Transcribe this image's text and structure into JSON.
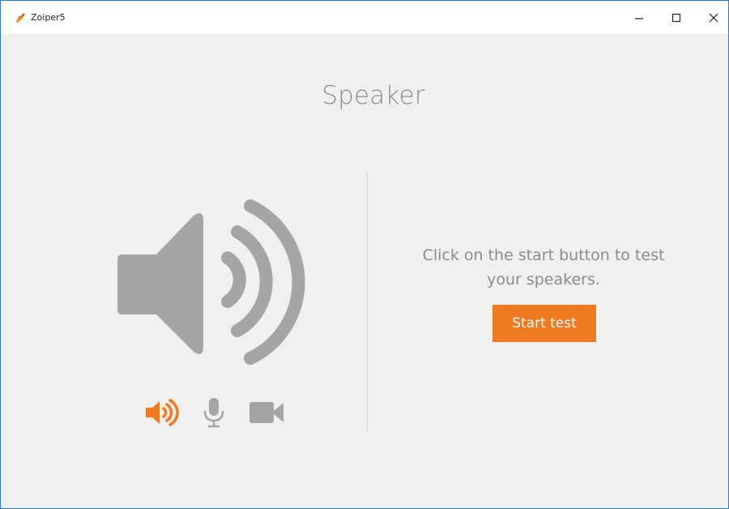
{
  "window": {
    "title": "Zoiper5"
  },
  "main": {
    "title": "Speaker",
    "instruction_line1": "Click on the start button to test",
    "instruction_line2": "your speakers.",
    "start_button_label": "Start test"
  },
  "tabs": [
    {
      "name": "speaker",
      "icon": "speaker-icon",
      "active": true
    },
    {
      "name": "microphone",
      "icon": "microphone-icon",
      "active": false
    },
    {
      "name": "video",
      "icon": "video-camera-icon",
      "active": false
    }
  ],
  "colors": {
    "accent": "#f07a22",
    "icon_gray": "#a5a5a7",
    "text_gray": "#8c8c8c",
    "background": "#f0f0f0"
  }
}
